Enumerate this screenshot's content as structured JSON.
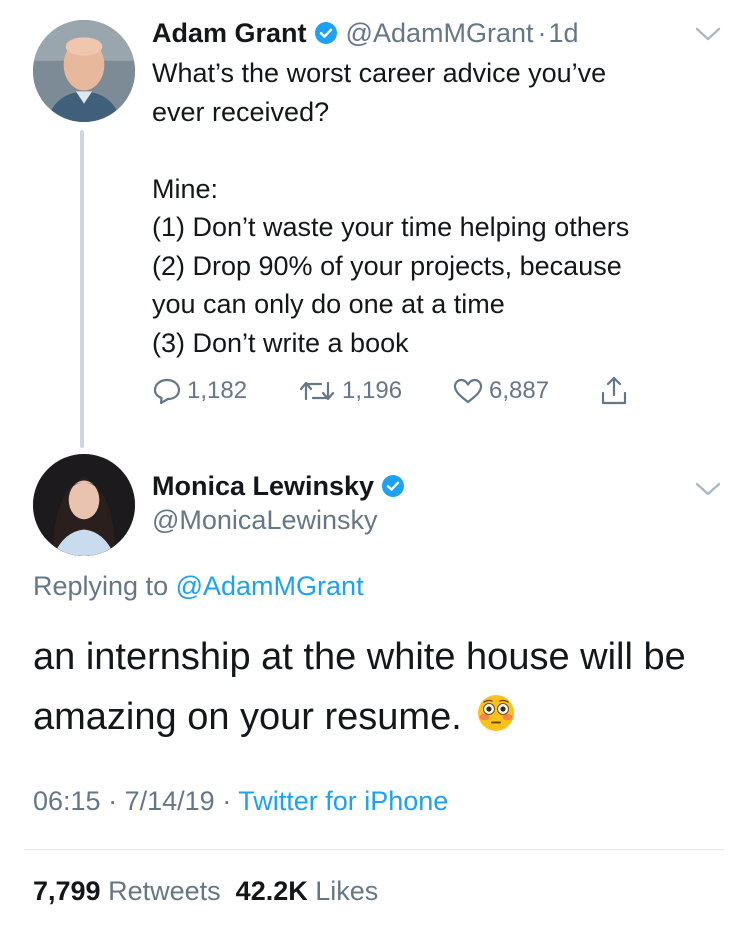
{
  "parent_tweet": {
    "author_name": "Adam Grant",
    "handle": "@AdamMGrant",
    "separator": "·",
    "age": "1d",
    "text": "What’s the worst career advice you’ve\never received?\n\nMine:\n(1) Don’t waste your time helping others\n(2) Drop 90% of your projects, because\nyou can only do one at a time\n(3) Don’t write a book",
    "reply_count": "1,182",
    "retweet_count": "1,196",
    "like_count": "6,887",
    "icons": [
      "reply-icon",
      "retweet-icon",
      "like-icon",
      "share-icon",
      "verified-badge-icon",
      "chevron-down-icon"
    ]
  },
  "reply_tweet": {
    "author_name": "Monica Lewinsky",
    "handle": "@MonicaLewinsky",
    "replying_prefix": "Replying to",
    "replying_to": "@AdamMGrant",
    "text": "an internship at the white house will be amazing on your resume.",
    "emoji": "flushed-face-emoji",
    "time": "06:15",
    "date": "7/14/19",
    "separator": "·",
    "source": "Twitter for iPhone",
    "retweets_count": "7,799",
    "retweets_label": "Retweets",
    "likes_count": "42.2K",
    "likes_label": "Likes"
  },
  "colors": {
    "text": "#14171a",
    "secondary": "#657786",
    "accent": "#1da1f2",
    "thread_line": "#ccd6dd",
    "divider": "#e1e8ed"
  }
}
